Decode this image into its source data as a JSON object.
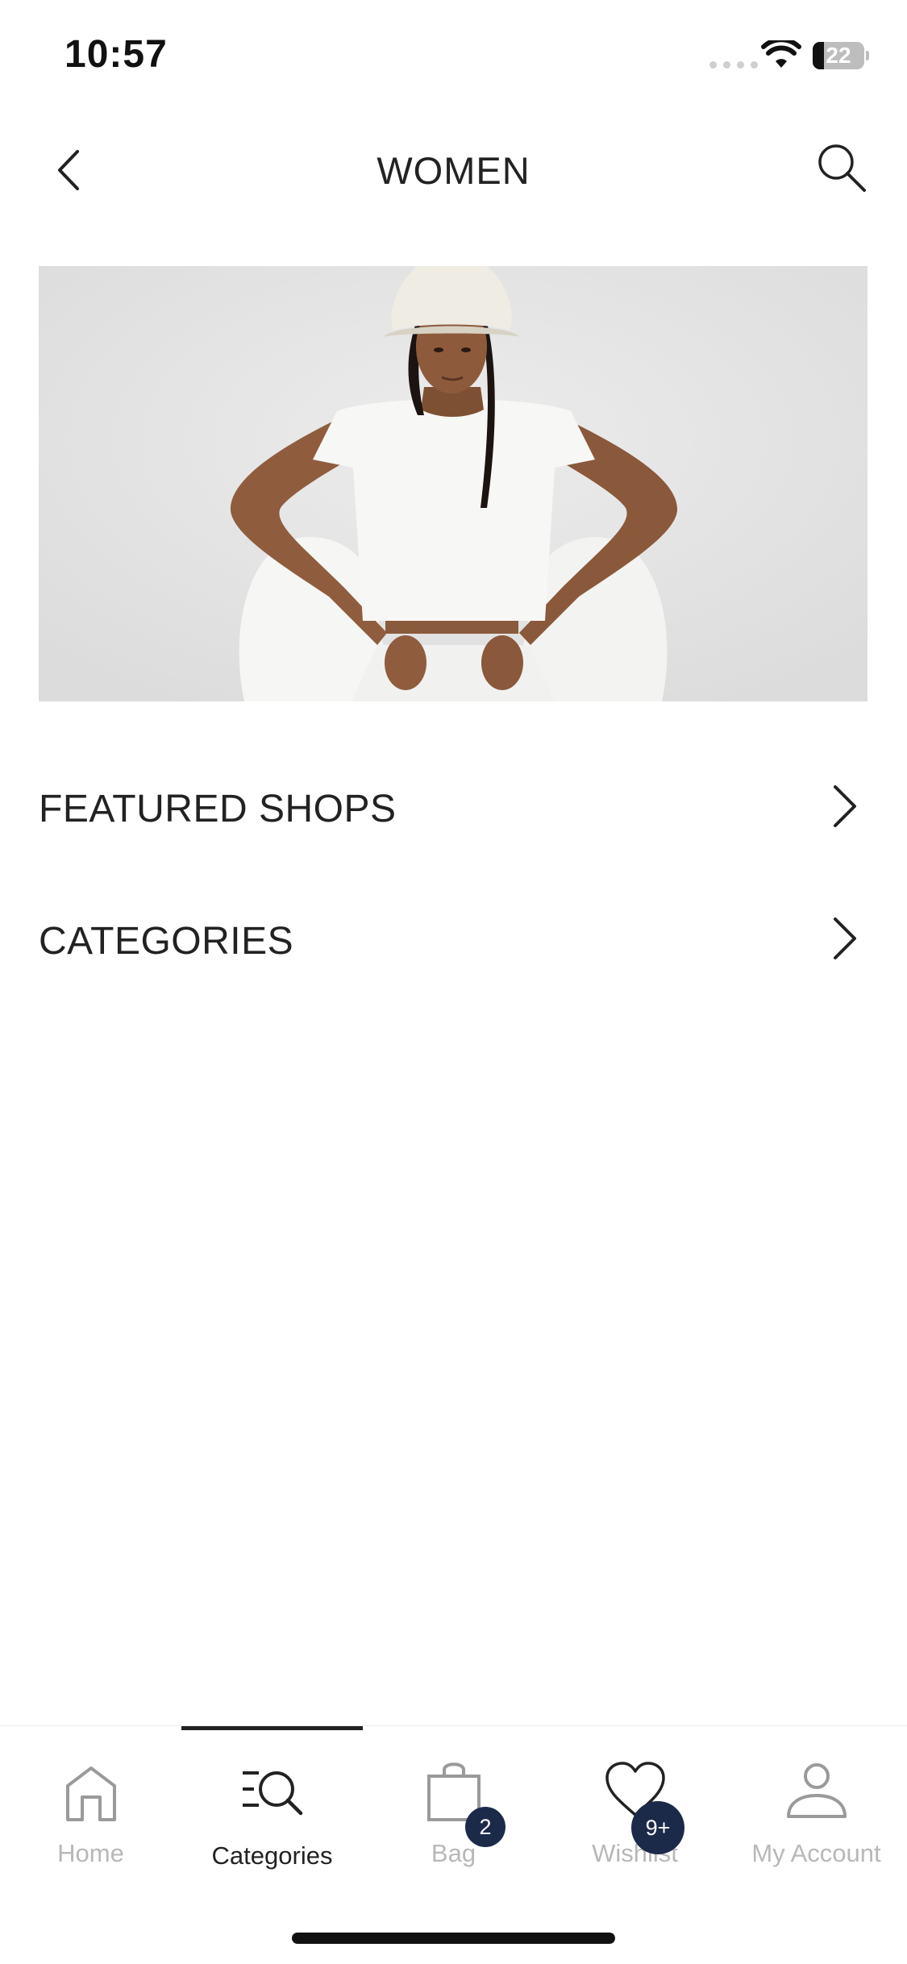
{
  "status_bar": {
    "time": "10:57",
    "battery_level": "22",
    "battery_fraction": 0.22
  },
  "header": {
    "title": "WOMEN",
    "back_icon": "chevron-left-icon",
    "search_icon": "search-icon"
  },
  "hero": {
    "image": "woman-in-white-bucket-hat-and-white-outfit"
  },
  "menu": {
    "items": [
      {
        "label": "FEATURED SHOPS"
      },
      {
        "label": "CATEGORIES"
      }
    ]
  },
  "tab_bar": {
    "active_index": 1,
    "tabs": [
      {
        "label": "Home",
        "icon": "home-icon"
      },
      {
        "label": "Categories",
        "icon": "categories-search-icon"
      },
      {
        "label": "Bag",
        "icon": "bag-icon",
        "badge": "2"
      },
      {
        "label": "Wishlist",
        "icon": "heart-icon",
        "badge": "9+"
      },
      {
        "label": "My Account",
        "icon": "user-icon"
      }
    ]
  },
  "colors": {
    "accent": "#222222",
    "badge": "#1c2a4a",
    "inactive_label": "#b8b8b8",
    "hero_background": "#e3e3e3"
  }
}
